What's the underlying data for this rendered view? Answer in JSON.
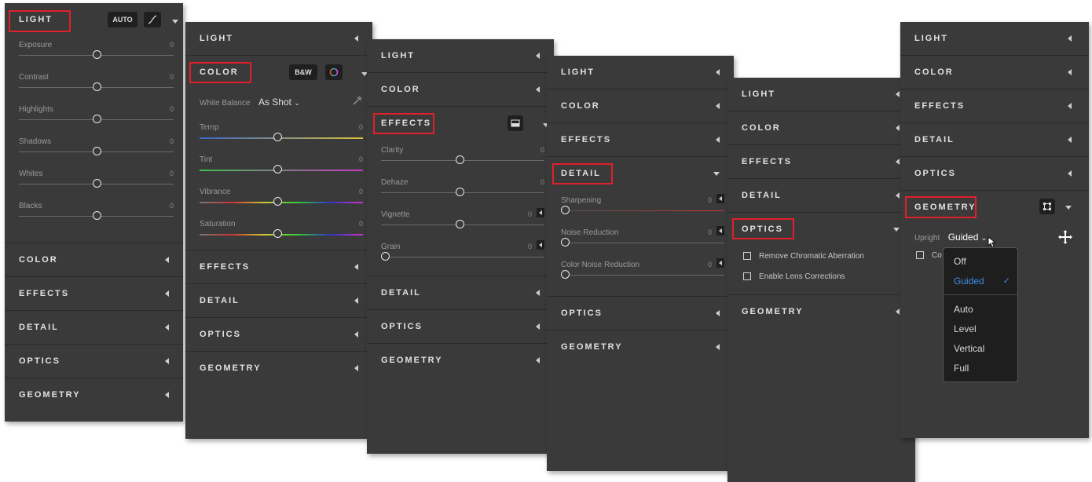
{
  "sections": {
    "light": "LIGHT",
    "color": "COLOR",
    "effects": "EFFECTS",
    "detail": "DETAIL",
    "optics": "OPTICS",
    "geometry": "GEOMETRY"
  },
  "light_panel": {
    "auto_label": "AUTO",
    "sliders": [
      {
        "label": "Exposure",
        "value": "0"
      },
      {
        "label": "Contrast",
        "value": "0"
      },
      {
        "label": "Highlights",
        "value": "0"
      },
      {
        "label": "Shadows",
        "value": "0"
      },
      {
        "label": "Whites",
        "value": "0"
      },
      {
        "label": "Blacks",
        "value": "0"
      }
    ]
  },
  "color_panel": {
    "bw_label": "B&W",
    "white_balance_label": "White Balance",
    "white_balance_value": "As Shot",
    "sliders": [
      {
        "label": "Temp",
        "value": "0"
      },
      {
        "label": "Tint",
        "value": "0"
      },
      {
        "label": "Vibrance",
        "value": "0"
      },
      {
        "label": "Saturation",
        "value": "0"
      }
    ]
  },
  "effects_panel": {
    "sliders": [
      {
        "label": "Clarity",
        "value": "0"
      },
      {
        "label": "Dehaze",
        "value": "0"
      },
      {
        "label": "Vignette",
        "value": "0"
      },
      {
        "label": "Grain",
        "value": "0"
      }
    ]
  },
  "detail_panel": {
    "sliders": [
      {
        "label": "Sharpening",
        "value": "0"
      },
      {
        "label": "Noise Reduction",
        "value": "0"
      },
      {
        "label": "Color Noise Reduction",
        "value": "0"
      }
    ]
  },
  "optics_panel": {
    "checkboxes": [
      "Remove Chromatic Aberration",
      "Enable Lens Corrections"
    ]
  },
  "geometry_panel": {
    "upright_label": "Upright",
    "upright_value": "Guided",
    "constrain_partial": "Co",
    "options": [
      "Off",
      "Guided",
      "Auto",
      "Level",
      "Vertical",
      "Full"
    ],
    "selected_option": "Guided",
    "accent_color": "#3d8ee8"
  },
  "highlight_color": "#e0202a"
}
